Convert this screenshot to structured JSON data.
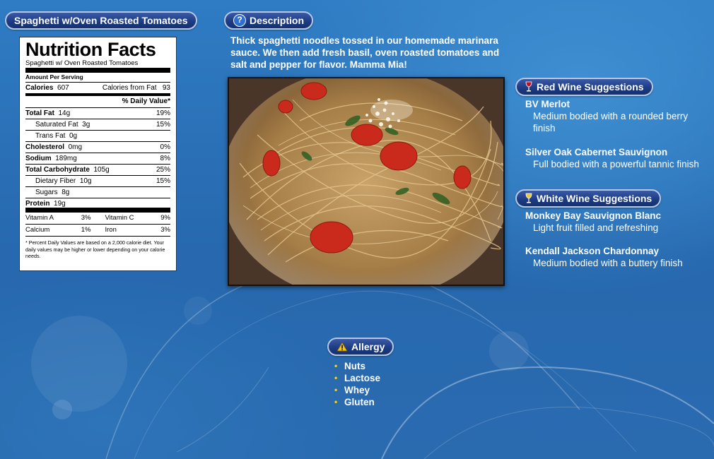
{
  "dish": {
    "title": "Spaghetti w/Oven Roasted Tomatoes"
  },
  "nutrition": {
    "heading": "Nutrition Facts",
    "subheading": "Spaghetti w/ Oven Roasted Tomatoes",
    "amount_per_serving": "Amount Per Serving",
    "calories_label": "Calories",
    "calories": "607",
    "calories_fat_label": "Calories from Fat",
    "calories_fat": "93",
    "daily_value_header": "% Daily Value*",
    "rows": [
      {
        "label": "Total Fat",
        "amount": "14g",
        "dv": "19%"
      },
      {
        "label": "Saturated Fat",
        "amount": "3g",
        "dv": "15%"
      },
      {
        "label": "Trans Fat",
        "amount": "0g",
        "dv": ""
      },
      {
        "label": "Cholesterol",
        "amount": "0mg",
        "dv": "0%"
      },
      {
        "label": "Sodium",
        "amount": "189mg",
        "dv": "8%"
      },
      {
        "label": "Total Carbohydrate",
        "amount": "105g",
        "dv": "25%"
      },
      {
        "label": "Dietary Fiber",
        "amount": "10g",
        "dv": "15%"
      },
      {
        "label": "Sugars",
        "amount": "8g",
        "dv": ""
      },
      {
        "label": "Protein",
        "amount": "19g",
        "dv": ""
      }
    ],
    "vitamins": [
      {
        "label": "Vitamin A",
        "value": "3%"
      },
      {
        "label": "Vitamin C",
        "value": "9%"
      },
      {
        "label": "Calcium",
        "value": "1%"
      },
      {
        "label": "Iron",
        "value": "3%"
      }
    ],
    "footnote": "* Percent Daily Values are based on a 2,000 calorie diet. Your daily values may be higher or lower depending on your calorie needs."
  },
  "description": {
    "label": "Description",
    "text": "Thick spaghetti noodles tossed in our homemade marinara sauce. We then add fresh basil, oven roasted tomatoes and salt and pepper for flavor. Mamma Mia!"
  },
  "red_wine": {
    "label": "Red Wine Suggestions",
    "items": [
      {
        "name": "BV Merlot",
        "desc": "Medium bodied with a rounded berry finish"
      },
      {
        "name": "Silver Oak Cabernet Sauvignon",
        "desc": "Full bodied with a powerful tannic finish"
      }
    ]
  },
  "white_wine": {
    "label": "White Wine Suggestions",
    "items": [
      {
        "name": "Monkey Bay Sauvignon Blanc",
        "desc": "Light fruit filled and refreshing"
      },
      {
        "name": "Kendall Jackson Chardonnay",
        "desc": "Medium bodied with a buttery finish"
      }
    ]
  },
  "allergy": {
    "label": "Allergy",
    "items": [
      "Nuts",
      "Lactose",
      "Whey",
      "Gluten"
    ]
  },
  "colors": {
    "background": "#2a6bb0",
    "pill": "#1b3a82",
    "pill_border": "#b7c8e4",
    "bullet": "#ffd700"
  }
}
